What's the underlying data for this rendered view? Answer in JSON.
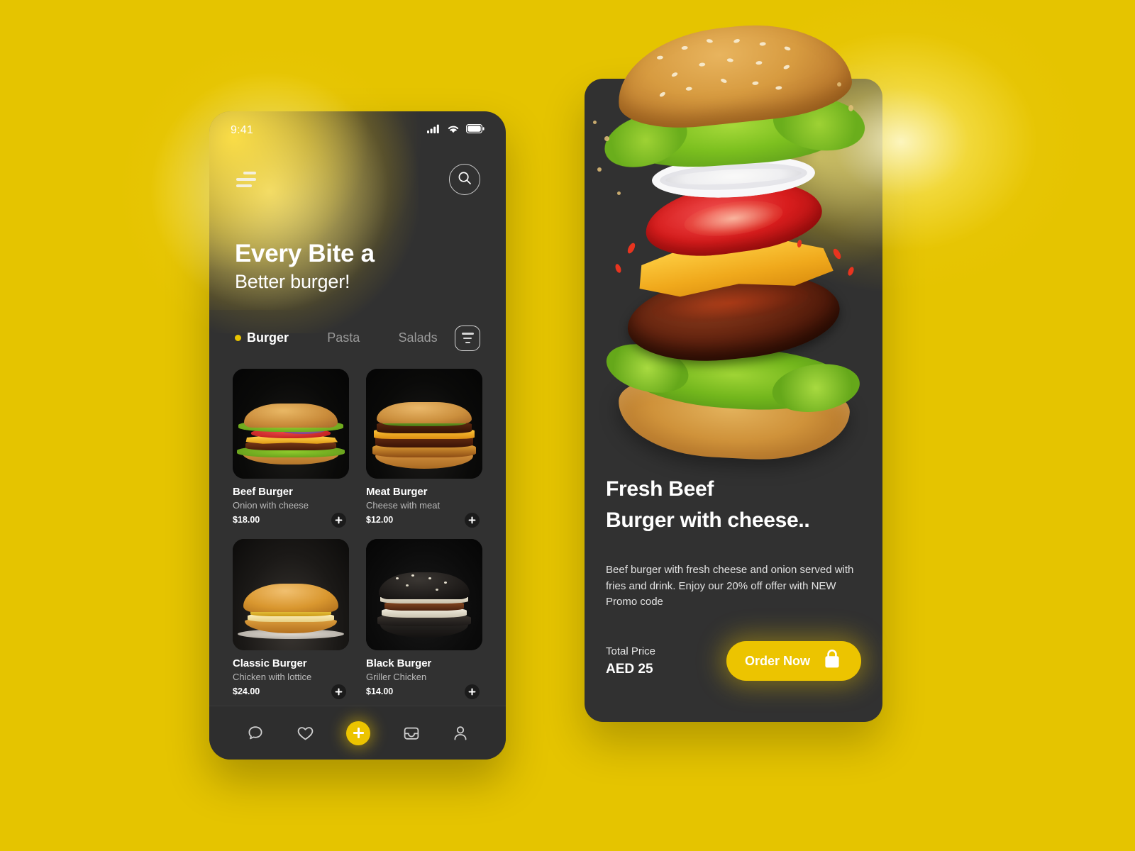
{
  "theme": {
    "background": "#e5c400",
    "card_dark": "#313131",
    "accent": "#ecc400",
    "text_primary": "#ffffff",
    "text_muted": "#b9b9b9"
  },
  "menu_screen": {
    "status_bar": {
      "time": "9:41",
      "icons": [
        "signal-icon",
        "wifi-icon",
        "battery-icon"
      ]
    },
    "nav": {
      "menu_icon": "hamburger-menu-icon",
      "search_icon": "search-icon"
    },
    "headline": {
      "line1": "Every Bite a",
      "line2": "Better burger!"
    },
    "tabs": [
      {
        "label": "Burger",
        "active": true
      },
      {
        "label": "Pasta",
        "active": false
      },
      {
        "label": "Salads",
        "active": false
      }
    ],
    "filter_icon": "filter-icon",
    "products": [
      {
        "name": "Beef Burger",
        "desc": "Onion with cheese",
        "price": "$18.00",
        "add": "+"
      },
      {
        "name": "Meat Burger",
        "desc": "Cheese with meat",
        "price": "$12.00",
        "add": "+"
      },
      {
        "name": "Classic Burger",
        "desc": "Chicken with lottice",
        "price": "$24.00",
        "add": "+"
      },
      {
        "name": "Black Burger",
        "desc": "Griller Chicken",
        "price": "$14.00",
        "add": "+"
      }
    ],
    "tab_bar": [
      {
        "icon": "chat-bubble-icon",
        "name": "messages"
      },
      {
        "icon": "heart-icon",
        "name": "favorites"
      },
      {
        "icon": "plus-icon",
        "name": "add"
      },
      {
        "icon": "bag-icon",
        "name": "orders"
      },
      {
        "icon": "person-icon",
        "name": "profile"
      }
    ]
  },
  "detail_screen": {
    "title_line1": "Fresh Beef",
    "title_line2": "Burger with cheese..",
    "description": "Beef burger with fresh cheese and onion served with fries and drink. Enjoy our 20% off offer with NEW Promo code",
    "total_price_label": "Total Price",
    "total_price_value": "AED 25",
    "order_button_label": "Order Now",
    "order_button_icon": "shopping-bag-icon"
  }
}
